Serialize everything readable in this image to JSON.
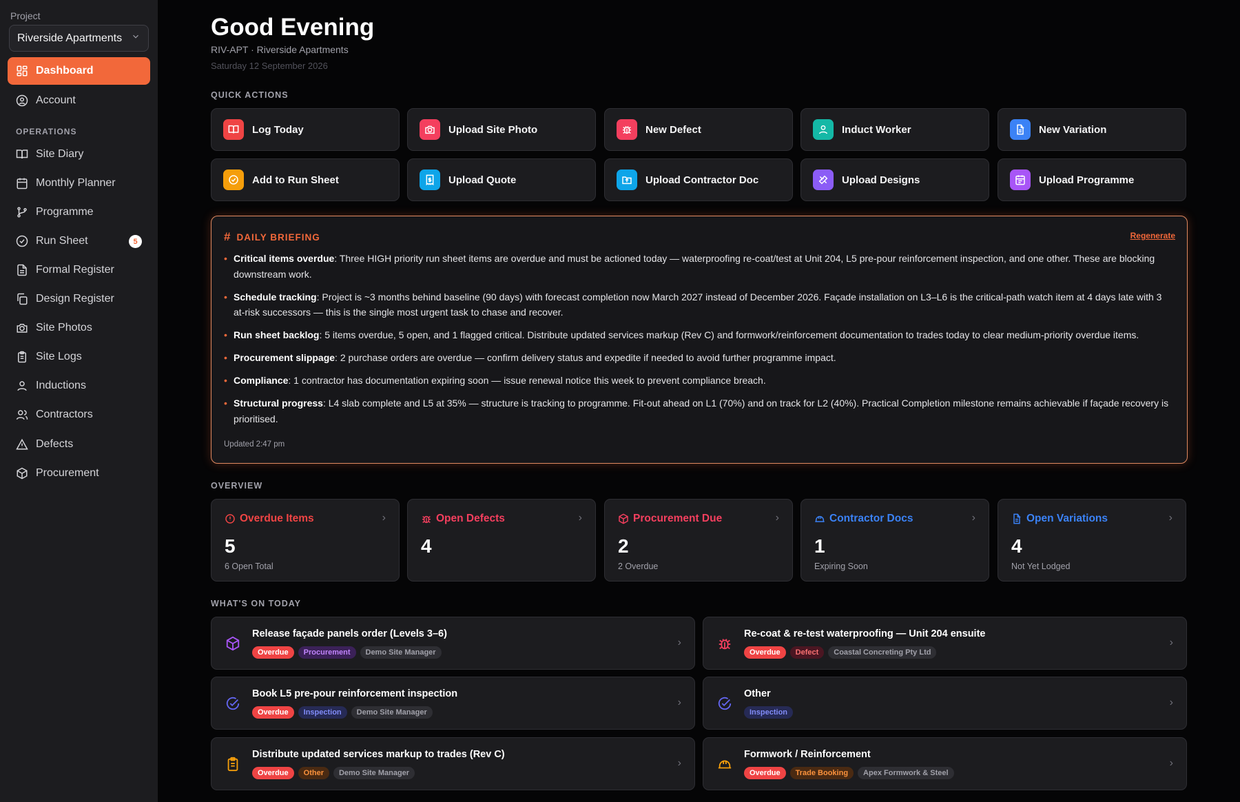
{
  "sidebar": {
    "project_label": "Project",
    "project_value": "Riverside Apartments",
    "items": [
      {
        "label": "Dashboard"
      },
      {
        "label": "Account"
      },
      {
        "label": "Site Diary"
      },
      {
        "label": "Monthly Planner"
      },
      {
        "label": "Programme"
      },
      {
        "label": "Run Sheet",
        "badge": "5"
      },
      {
        "label": "Formal Register"
      },
      {
        "label": "Design Register"
      },
      {
        "label": "Site Photos"
      },
      {
        "label": "Site Logs"
      },
      {
        "label": "Inductions"
      },
      {
        "label": "Contractors"
      },
      {
        "label": "Defects"
      },
      {
        "label": "Procurement"
      }
    ],
    "section_operations": "OPERATIONS"
  },
  "header": {
    "greeting": "Good Evening",
    "subline": "RIV-APT · Riverside Apartments",
    "date": "Saturday 12 September 2026"
  },
  "quick_actions": {
    "title": "QUICK ACTIONS",
    "items": [
      {
        "label": "Log Today",
        "icon": "book-icon",
        "color": "#ef4444"
      },
      {
        "label": "Upload Site Photo",
        "icon": "camera-icon",
        "color": "#f43f5e"
      },
      {
        "label": "New Defect",
        "icon": "bug-icon",
        "color": "#f43f5e"
      },
      {
        "label": "Induct Worker",
        "icon": "user-icon",
        "color": "#14b8a6"
      },
      {
        "label": "New Variation",
        "icon": "document-icon",
        "color": "#3b82f6"
      },
      {
        "label": "Add to Run Sheet",
        "icon": "check-circle-icon",
        "color": "#f59e0b"
      },
      {
        "label": "Upload Quote",
        "icon": "receipt-icon",
        "color": "#0ea5e9"
      },
      {
        "label": "Upload Contractor Doc",
        "icon": "folder-upload-icon",
        "color": "#0ea5e9"
      },
      {
        "label": "Upload Designs",
        "icon": "ruler-icon",
        "color": "#8b5cf6"
      },
      {
        "label": "Upload Programme",
        "icon": "calendar-icon",
        "color": "#a855f7"
      }
    ]
  },
  "briefing": {
    "title": "DAILY BRIEFING",
    "regenerate": "Regenerate",
    "items": [
      {
        "head": "Critical items overdue",
        "text": ": Three HIGH priority run sheet items are overdue and must be actioned today — waterproofing re-coat/test at Unit 204, L5 pre-pour reinforcement inspection, and one other. These are blocking downstream work."
      },
      {
        "head": "Schedule tracking",
        "text": ": Project is ~3 months behind baseline (90 days) with forecast completion now March 2027 instead of December 2026. Façade installation on L3–L6 is the critical-path watch item at 4 days late with 3 at-risk successors — this is the single most urgent task to chase and recover."
      },
      {
        "head": "Run sheet backlog",
        "text": ": 5 items overdue, 5 open, and 1 flagged critical. Distribute updated services markup (Rev C) and formwork/reinforcement documentation to trades today to clear medium-priority overdue items."
      },
      {
        "head": "Procurement slippage",
        "text": ": 2 purchase orders are overdue — confirm delivery status and expedite if needed to avoid further programme impact."
      },
      {
        "head": "Compliance",
        "text": ": 1 contractor has documentation expiring soon — issue renewal notice this week to prevent compliance breach."
      },
      {
        "head": "Structural progress",
        "text": ": L4 slab complete and L5 at 35% — structure is tracking to programme. Fit-out ahead on L1 (70%) and on track for L2 (40%). Practical Completion milestone remains achievable if façade recovery is prioritised."
      }
    ],
    "updated": "Updated 2:47 pm"
  },
  "overview": {
    "title": "OVERVIEW",
    "cards": [
      {
        "label": "Overdue Items",
        "value": "5",
        "sub": "6 Open Total",
        "color": "#ef4444",
        "icon": "alert-circle-icon"
      },
      {
        "label": "Open Defects",
        "value": "4",
        "sub": "",
        "color": "#f43f5e",
        "icon": "bug-icon"
      },
      {
        "label": "Procurement Due",
        "value": "2",
        "sub": "2 Overdue",
        "color": "#f43f5e",
        "icon": "package-icon"
      },
      {
        "label": "Contractor Docs",
        "value": "1",
        "sub": "Expiring Soon",
        "color": "#3b82f6",
        "icon": "hardhat-icon"
      },
      {
        "label": "Open Variations",
        "value": "4",
        "sub": "Not Yet Lodged",
        "color": "#3b82f6",
        "icon": "document-icon"
      }
    ]
  },
  "today": {
    "title": "WHAT'S ON TODAY",
    "tasks": [
      {
        "title": "Release façade panels order (Levels 3–6)",
        "icon": "package-icon",
        "tags": [
          "Overdue",
          "Procurement",
          "Demo Site Manager"
        ]
      },
      {
        "title": "Re-coat & re-test waterproofing — Unit 204 ensuite",
        "icon": "bug-icon",
        "tags": [
          "Overdue",
          "Defect",
          "Coastal Concreting Pty Ltd"
        ]
      },
      {
        "title": "Book L5 pre-pour reinforcement inspection",
        "icon": "check-circle-icon",
        "tags": [
          "Overdue",
          "Inspection",
          "Demo Site Manager"
        ]
      },
      {
        "title": "Other",
        "icon": "check-circle-icon",
        "tags": [
          "Inspection"
        ]
      },
      {
        "title": "Distribute updated services markup to trades (Rev C)",
        "icon": "clipboard-icon",
        "tags": [
          "Overdue",
          "Other",
          "Demo Site Manager"
        ]
      },
      {
        "title": "Formwork / Reinforcement",
        "icon": "hardhat-icon",
        "tags": [
          "Overdue",
          "Trade Booking",
          "Apex Formwork & Steel"
        ]
      }
    ]
  }
}
